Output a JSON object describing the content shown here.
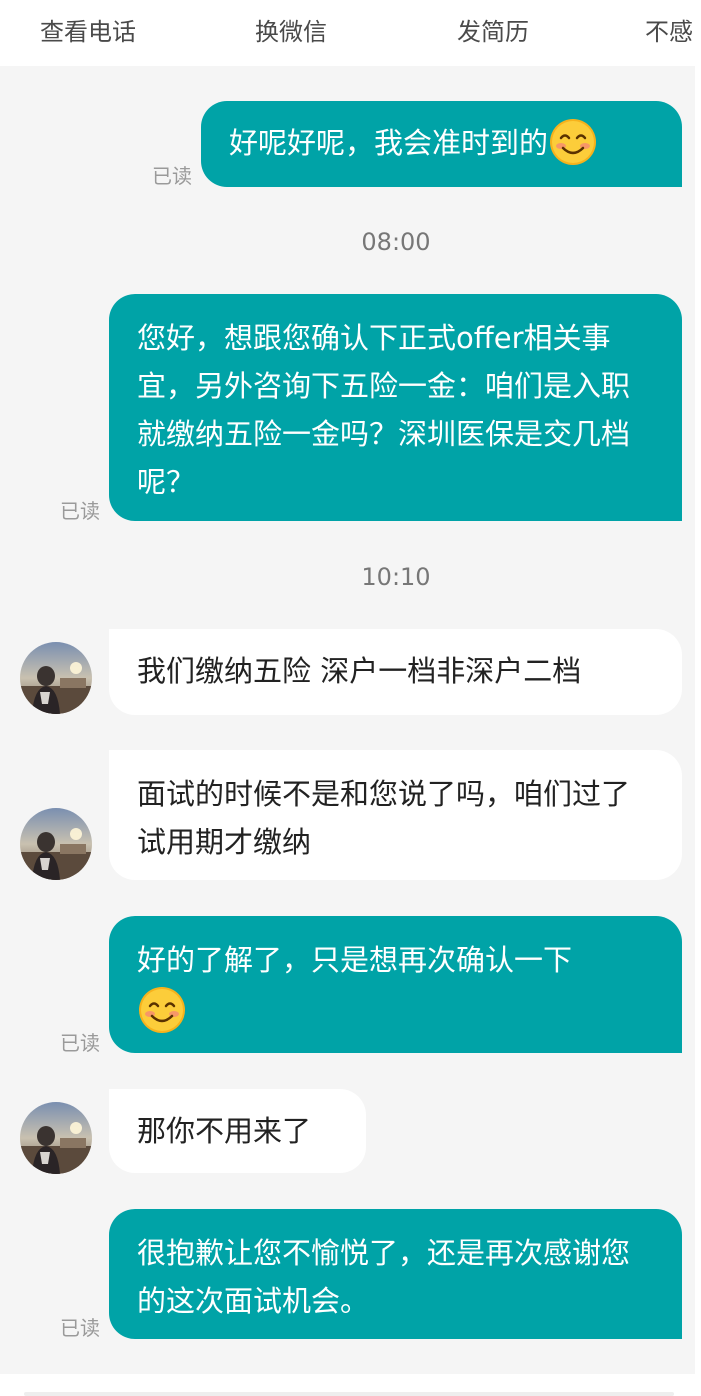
{
  "topbar": {
    "actions": [
      "查看电话",
      "换微信",
      "发简历",
      "不感"
    ]
  },
  "chat": {
    "read_label": "已读",
    "timestamps": [
      "08:00",
      "10:10"
    ],
    "messages": [
      {
        "from": "me",
        "text": "好呢好呢，我会准时到的",
        "emoji": "smiling-face-icon"
      },
      {
        "from": "me",
        "text": "您好，想跟您确认下正式offer相关事宜，另外咨询下五险一金：咱们是入职就缴纳五险一金吗？深圳医保是交几档呢？"
      },
      {
        "from": "them",
        "text": "我们缴纳五险 深户一档非深户二档"
      },
      {
        "from": "them",
        "text": "面试的时候不是和您说了吗，咱们过了试用期才缴纳"
      },
      {
        "from": "me",
        "text": "好的了解了，只是想再次确认一下",
        "emoji": "smiling-face-icon"
      },
      {
        "from": "them",
        "text": "那你不用来了"
      },
      {
        "from": "me",
        "text": "很抱歉让您不愉悦了，还是再次感谢您的这次面试机会。"
      }
    ]
  },
  "colors": {
    "my_bubble": "#00a3a7",
    "their_bubble": "#ffffff",
    "background": "#f5f5f5"
  }
}
